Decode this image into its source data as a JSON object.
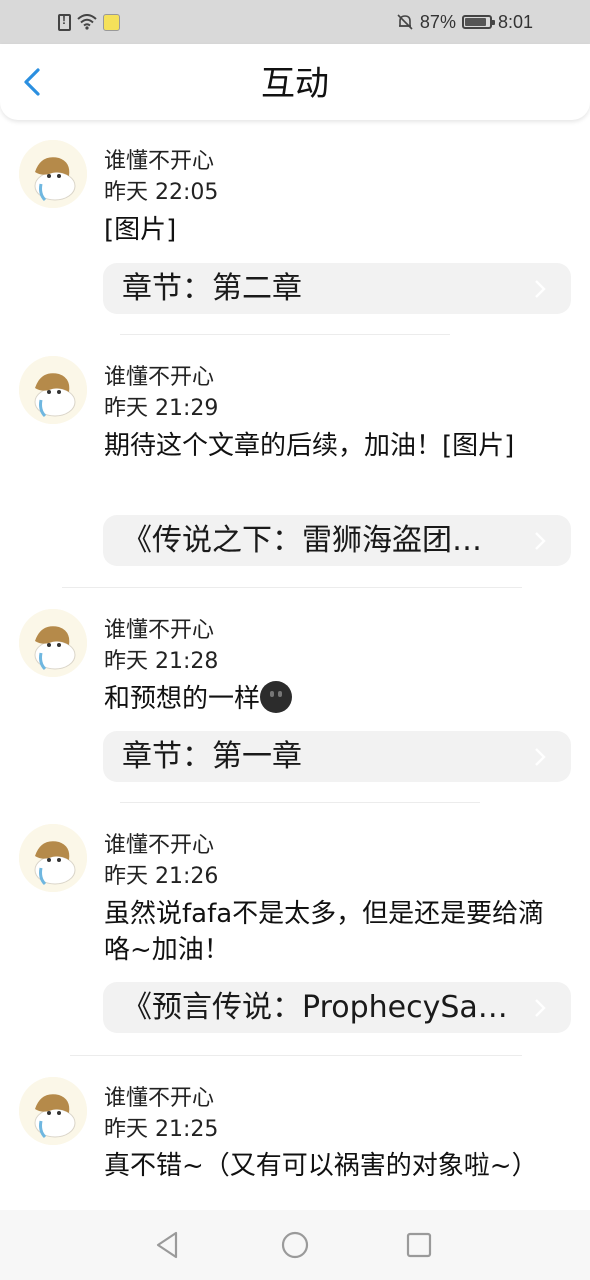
{
  "status_bar": {
    "battery": "87%",
    "time": "8:01",
    "icons": [
      "sim-alert-icon",
      "wifi-icon",
      "app-notification-icon",
      "mute-bell-icon",
      "battery-icon"
    ]
  },
  "header": {
    "title": "互动",
    "back_icon": "chevron-left-icon",
    "accent_color": "#2b8fe0"
  },
  "comments": [
    {
      "user": "谁懂不开心",
      "time": "昨天 22:05",
      "text": "[图片]",
      "ref": "章节：第二章"
    },
    {
      "user": "谁懂不开心",
      "time": "昨天 21:29",
      "text": "期待这个文章的后续，加油！[图片]",
      "ref": "《传说之下：雷狮海盗团…"
    },
    {
      "user": "谁懂不开心",
      "time": "昨天 21:28",
      "text": "和预想的一样",
      "emoji": "dark-smiley-emoji",
      "ref": "章节：第一章"
    },
    {
      "user": "谁懂不开心",
      "time": "昨天 21:26",
      "text": "虽然说fafa不是太多，但是还是要给滴咯~加油！",
      "ref": "《预言传说：ProphecySa…"
    },
    {
      "user": "谁懂不开心",
      "time": "昨天 21:25",
      "text": "真不错~（又有可以祸害的对象啦~）"
    }
  ],
  "nav_bar": {
    "icons": [
      "back-triangle-icon",
      "home-circle-icon",
      "recents-square-icon"
    ]
  }
}
